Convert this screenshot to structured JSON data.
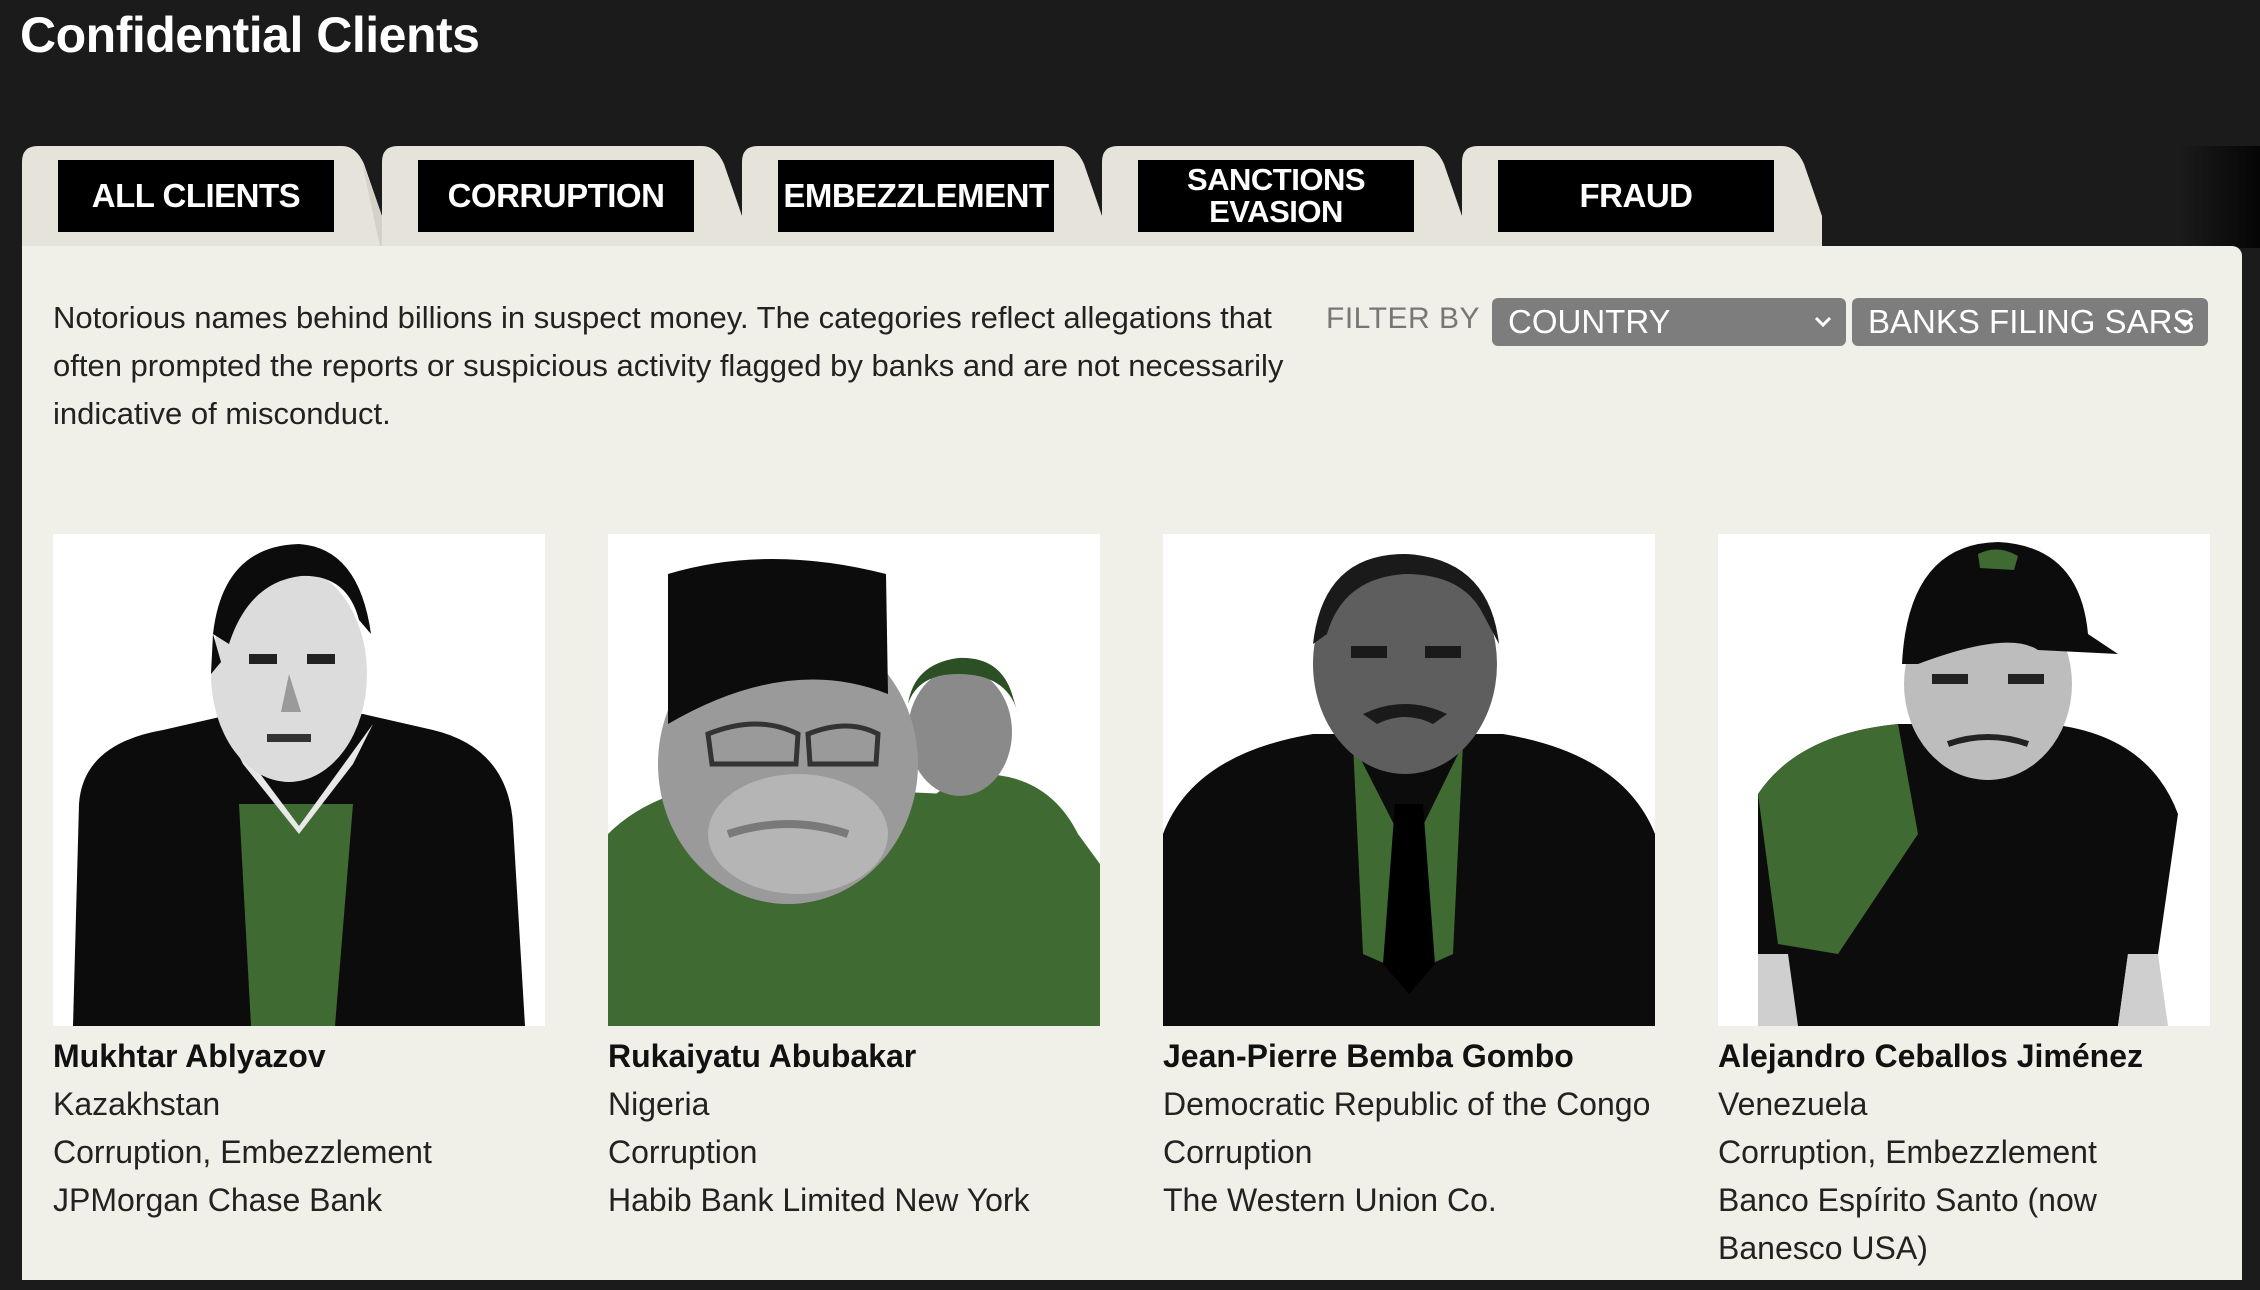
{
  "header": {
    "title": "Confidential Clients"
  },
  "tabs": [
    {
      "label": "ALL CLIENTS"
    },
    {
      "label": "CORRUPTION"
    },
    {
      "label": "EMBEZZLEMENT"
    },
    {
      "label": "SANCTIONS EVASION"
    },
    {
      "label": "FRAUD"
    }
  ],
  "intro": "Notorious names behind billions in suspect money. The categories reflect allegations that often prompted the reports or suspicious activity flagged by banks and are not necessarily indicative of misconduct.",
  "filters": {
    "label": "FILTER BY",
    "country": "COUNTRY",
    "banks": "BANKS FILING SARS"
  },
  "clients": [
    {
      "name": "Mukhtar Ablyazov",
      "country": "Kazakhstan",
      "categories": "Corruption, Embezzlement",
      "bank": "JPMorgan Chase Bank"
    },
    {
      "name": "Rukaiyatu Abubakar",
      "country": "Nigeria",
      "categories": "Corruption",
      "bank": "Habib Bank Limited New York"
    },
    {
      "name": "Jean-Pierre Bemba Gombo",
      "country": "Democratic Republic of the Congo",
      "categories": "Corruption",
      "bank": "The Western Union Co."
    },
    {
      "name": "Alejandro Ceballos Jiménez",
      "country": "Venezuela",
      "categories": "Corruption, Embezzlement",
      "bank": "Banco Espírito Santo (now Banesco USA)"
    }
  ],
  "colors": {
    "background": "#1b1b1b",
    "panel": "#f0efe8",
    "tab": "#e6e4da",
    "select": "#7d7d7d",
    "portrait_green": "#3f6b33"
  }
}
